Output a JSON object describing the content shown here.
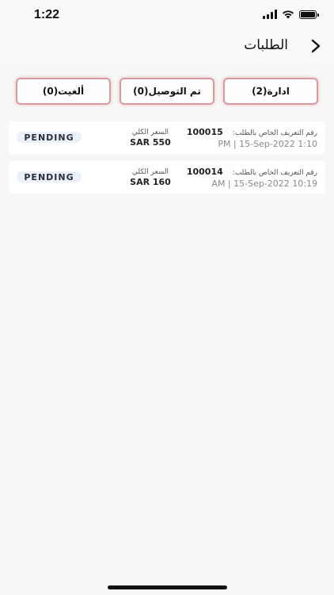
{
  "status_bar": {
    "time": "1:22"
  },
  "header": {
    "title": "الطلبات"
  },
  "tabs": [
    {
      "label": "ألغيت(0)"
    },
    {
      "label": "تم التوصيل(0)"
    },
    {
      "label": "ادارة(2)"
    }
  ],
  "orders": [
    {
      "id_label": "رقم التعريف الخاص بالطلب:",
      "id": "100015",
      "date": "PM | 15-Sep-2022 1:10",
      "total_label": "السعر الكلي",
      "total": "SAR 550",
      "status": "PENDING"
    },
    {
      "id_label": "رقم التعريف الخاص بالطلب:",
      "id": "100014",
      "date": "AM | 15-Sep-2022 10:19",
      "total_label": "السعر الكلي",
      "total": "SAR 160",
      "status": "PENDING"
    }
  ],
  "colors": {
    "tab_border": "#d99a9f",
    "status_pill_bg": "#eaf1fa",
    "background": "#f7f7f7"
  },
  "icons": {
    "back": "chevron-right-icon",
    "wifi": "wifi-icon",
    "signal": "cellular-signal-icon",
    "battery": "battery-icon"
  }
}
